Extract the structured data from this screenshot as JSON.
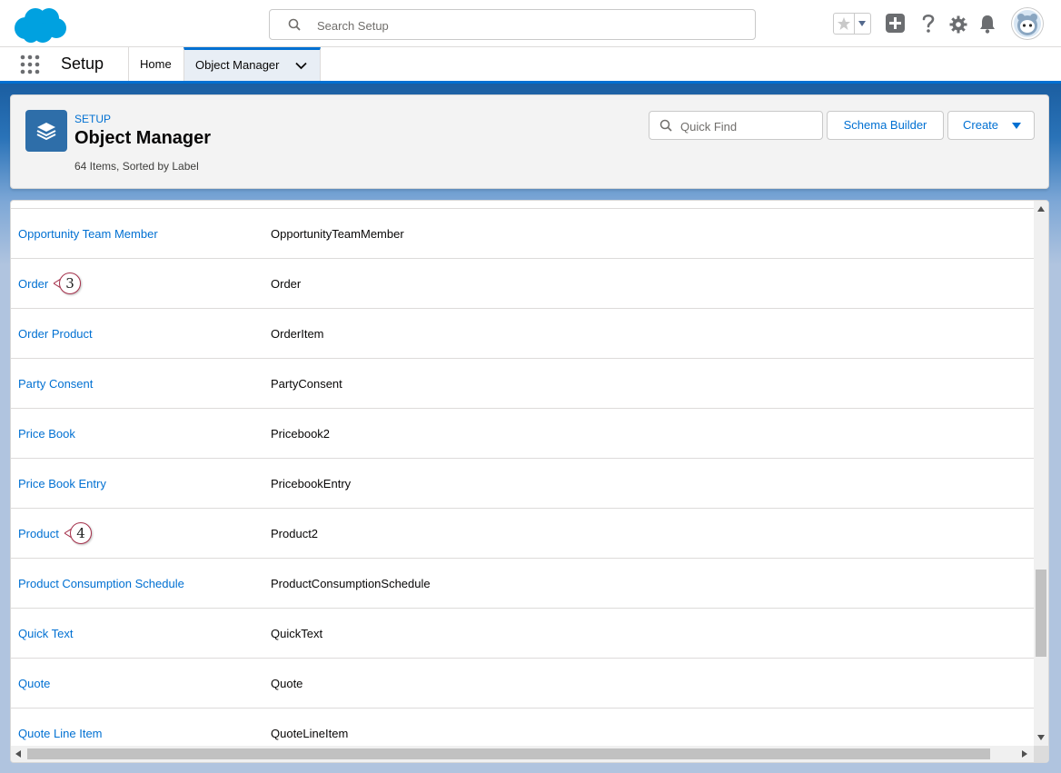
{
  "global_header": {
    "search_placeholder": "Search Setup"
  },
  "context_bar": {
    "app_name": "Setup",
    "tabs": [
      {
        "label": "Home"
      },
      {
        "label": "Object Manager"
      }
    ]
  },
  "page_header": {
    "eyebrow": "SETUP",
    "title": "Object Manager",
    "meta": "64 Items, Sorted by Label",
    "quick_find_placeholder": "Quick Find",
    "schema_builder_label": "Schema Builder",
    "create_label": "Create"
  },
  "objects": [
    {
      "label": "Opportunity Team Member",
      "api_name": "OpportunityTeamMember"
    },
    {
      "label": "Order",
      "api_name": "Order",
      "callout": "3"
    },
    {
      "label": "Order Product",
      "api_name": "OrderItem"
    },
    {
      "label": "Party Consent",
      "api_name": "PartyConsent"
    },
    {
      "label": "Price Book",
      "api_name": "Pricebook2"
    },
    {
      "label": "Price Book Entry",
      "api_name": "PricebookEntry"
    },
    {
      "label": "Product",
      "api_name": "Product2",
      "callout": "4"
    },
    {
      "label": "Product Consumption Schedule",
      "api_name": "ProductConsumptionSchedule"
    },
    {
      "label": "Quick Text",
      "api_name": "QuickText"
    },
    {
      "label": "Quote",
      "api_name": "Quote"
    },
    {
      "label": "Quote Line Item",
      "api_name": "QuoteLineItem"
    }
  ],
  "colors": {
    "link": "#0070d2",
    "brand_blue": "#1b5ea1",
    "object_icon": "#2e6ea9",
    "callout_border": "#a5304b"
  }
}
